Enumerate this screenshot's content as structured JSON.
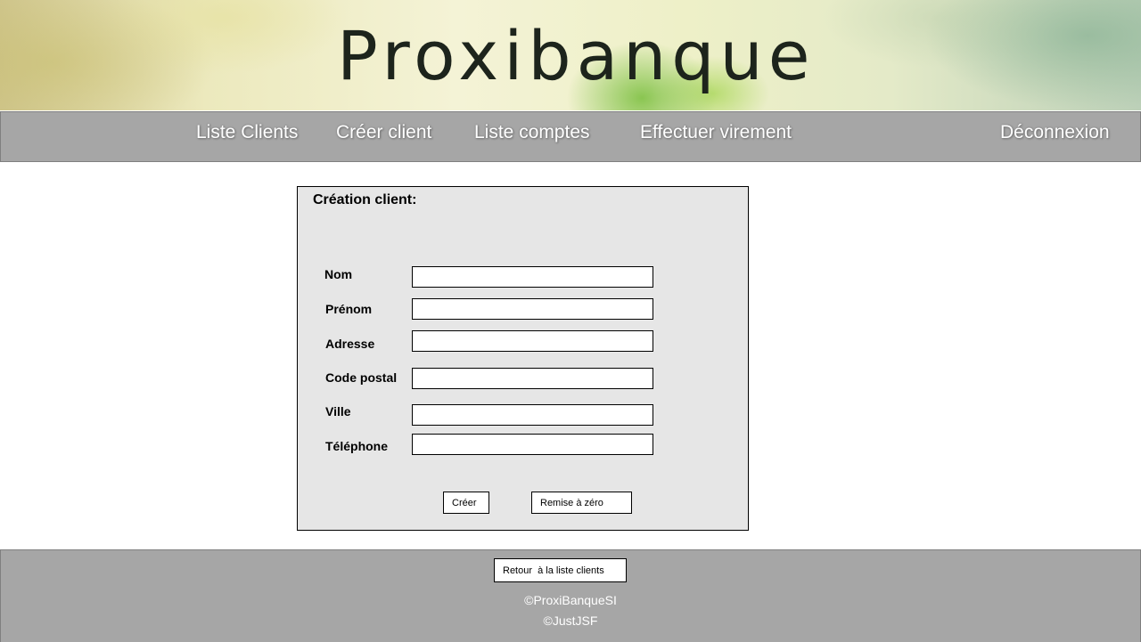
{
  "brand": {
    "logo_text": "Proxibanque"
  },
  "nav": {
    "liste_clients": "Liste Clients",
    "creer_client": "Créer client",
    "liste_comptes": "Liste comptes",
    "effectuer_virement": "Effectuer virement",
    "deconnexion": "Déconnexion"
  },
  "form": {
    "title": "Création client:",
    "fields": {
      "nom": {
        "label": "Nom",
        "value": ""
      },
      "prenom": {
        "label": "Prénom",
        "value": ""
      },
      "adresse": {
        "label": "Adresse",
        "value": ""
      },
      "code_postal": {
        "label": "Code postal",
        "value": ""
      },
      "ville": {
        "label": "Ville",
        "value": ""
      },
      "telephone": {
        "label": "Téléphone",
        "value": ""
      }
    },
    "submit_label": "Créer",
    "reset_label": "Remise à zéro"
  },
  "footer": {
    "back_label": "Retour  à la liste clients",
    "copyright_1": "©ProxiBanqueSI",
    "copyright_2": "©JustJSF"
  },
  "colors": {
    "nav_bg": "#a6a6a6",
    "panel_bg": "#e6e6e6",
    "nav_text": "#ffffff"
  }
}
